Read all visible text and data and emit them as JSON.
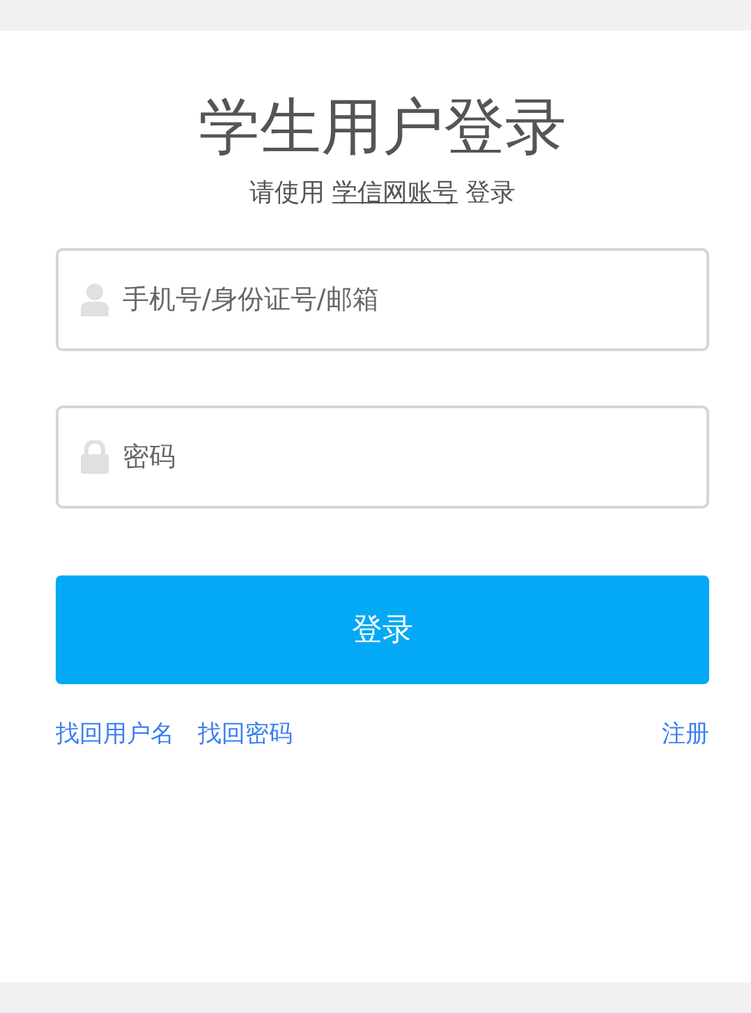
{
  "title": "学生用户登录",
  "subtitle": {
    "before": "请使用 ",
    "link": "学信网账号",
    "after": " 登录"
  },
  "fields": [
    {
      "kind": "user",
      "placeholder": "手机号/身份证号/邮箱"
    },
    {
      "kind": "lock",
      "placeholder": "密码"
    }
  ],
  "submit": "登录",
  "links_left": [
    "找回用户名",
    "找回密码"
  ],
  "links_right": [
    "注册"
  ]
}
